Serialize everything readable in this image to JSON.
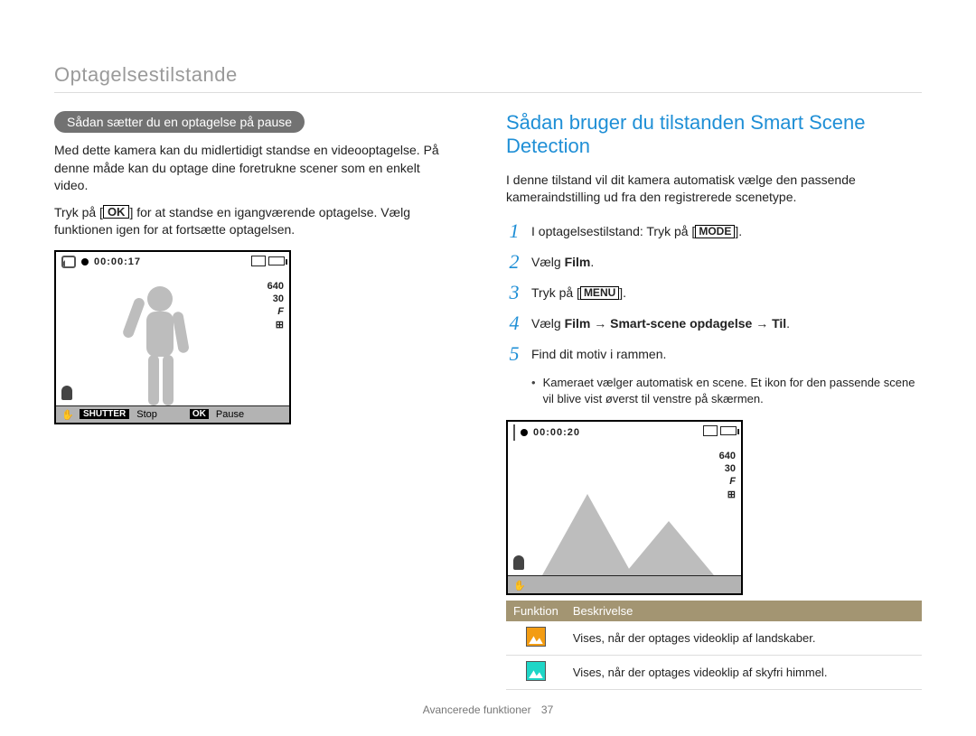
{
  "header": "Optagelsestilstande",
  "left": {
    "pill": "Sådan sætter du en optagelse på pause",
    "para1": "Med dette kamera kan du midlertidigt standse en videooptagelse. På denne måde kan du optage dine foretrukne scener som en enkelt video.",
    "para2_pre": "Tryk på [",
    "para2_btn": "OK",
    "para2_post": "] for at standse en igangværende optagelse. Vælg funktionen igen for at fortsætte optagelsen.",
    "preview": {
      "time": "00:00:17",
      "res": "640",
      "fps": "30",
      "focus_icon": "F",
      "smartfilter_icon": "⊞",
      "shutter_label": "SHUTTER",
      "stop_label": "Stop",
      "ok_label": "OK",
      "pause_label": "Pause"
    }
  },
  "right": {
    "title": "Sådan bruger du tilstanden Smart Scene Detection",
    "intro": "I denne tilstand vil dit kamera automatisk vælge den passende kameraindstilling ud fra den registrerede scenetype.",
    "steps": [
      {
        "n": "1",
        "pre": "I optagelsestilstand: Tryk på [",
        "btn": "MODE",
        "post": "]."
      },
      {
        "n": "2",
        "pre": "Vælg ",
        "bold": "Film",
        "post": "."
      },
      {
        "n": "3",
        "pre": "Tryk på [",
        "btn": "MENU",
        "post": "]."
      },
      {
        "n": "4",
        "pre": "Vælg ",
        "bold": "Film → Smart-scene opdagelse → Til",
        "post": "."
      },
      {
        "n": "5",
        "pre": "Find dit motiv i rammen.",
        "post": ""
      }
    ],
    "bullet": "Kameraet vælger automatisk en scene. Et ikon for den passende scene vil blive vist øverst til venstre på skærmen.",
    "preview": {
      "time": "00:00:20",
      "res": "640",
      "fps": "30",
      "focus_icon": "F",
      "smartfilter_icon": "⊞"
    },
    "table": {
      "h1": "Funktion",
      "h2": "Beskrivelse",
      "rows": [
        {
          "icon": "orange",
          "desc": "Vises, når der optages videoklip af landskaber."
        },
        {
          "icon": "blue",
          "desc": "Vises, når der optages videoklip af skyfri himmel."
        }
      ]
    }
  },
  "footer": {
    "section": "Avancerede funktioner",
    "page": "37"
  }
}
